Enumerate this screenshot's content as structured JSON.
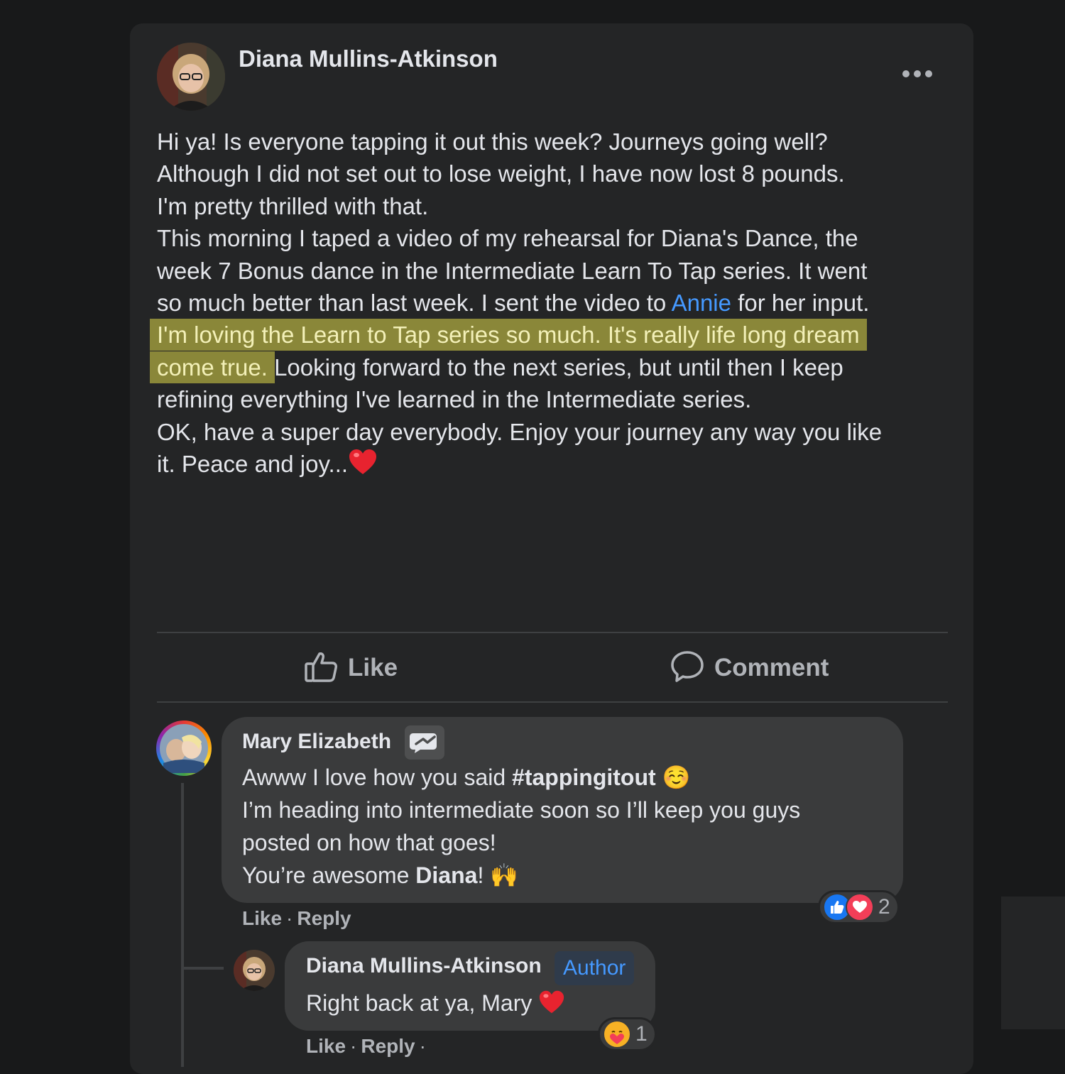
{
  "post": {
    "author": "Diana Mullins-Atkinson",
    "body_lines": [
      "Hi ya! Is everyone tapping it out this week? Journeys going well?",
      "Although I did not set out to lose weight, I have now lost 8 pounds.",
      "I'm pretty thrilled with that.",
      "This morning I taped a video of my rehearsal for Diana's Dance, the",
      "week 7 Bonus dance in the Intermediate Learn To Tap series. It went"
    ],
    "line6_before": "so much better than last week. I sent the video to ",
    "mention": "Annie",
    "line6_after": " for her input.",
    "highlight_line1": "I'm loving the Learn to Tap series so much. It's really life long dream",
    "highlight_line2": "come true.",
    "line8_after": " Looking forward to the next series, but until then I keep",
    "line9": "refining everything I've learned in the Intermediate series.",
    "line10": "OK, have a super day everybody. Enjoy your journey any way you like",
    "line11": "it. Peace and joy...",
    "actions": {
      "like_label": "Like",
      "comment_label": "Comment"
    }
  },
  "comments": [
    {
      "author": "Mary Elizabeth",
      "line1_before": "Awww I love how you said ",
      "hashtag": "#tappingitout",
      "line1_emoji": "☺️",
      "line2": "I’m heading into intermediate soon so I’ll keep you guys",
      "line3": "posted on how that goes!",
      "line4_before": "You’re awesome ",
      "line4_name": "Diana",
      "line4_after": "!",
      "line4_emoji": "🙌",
      "like_label": "Like",
      "reply_label": "Reply",
      "reaction_count": "2",
      "reactions": [
        "like",
        "love"
      ]
    },
    {
      "author": "Diana Mullins-Atkinson",
      "badge": "Author",
      "text": "Right back at ya, Mary",
      "like_label": "Like",
      "reply_label": "Reply",
      "reaction_count": "1",
      "reactions": [
        "care"
      ]
    }
  ],
  "colors": {
    "background": "#18191a",
    "card": "#242526",
    "bubble": "#3a3b3c",
    "link": "#4599ff",
    "highlight": "#8a8739"
  }
}
